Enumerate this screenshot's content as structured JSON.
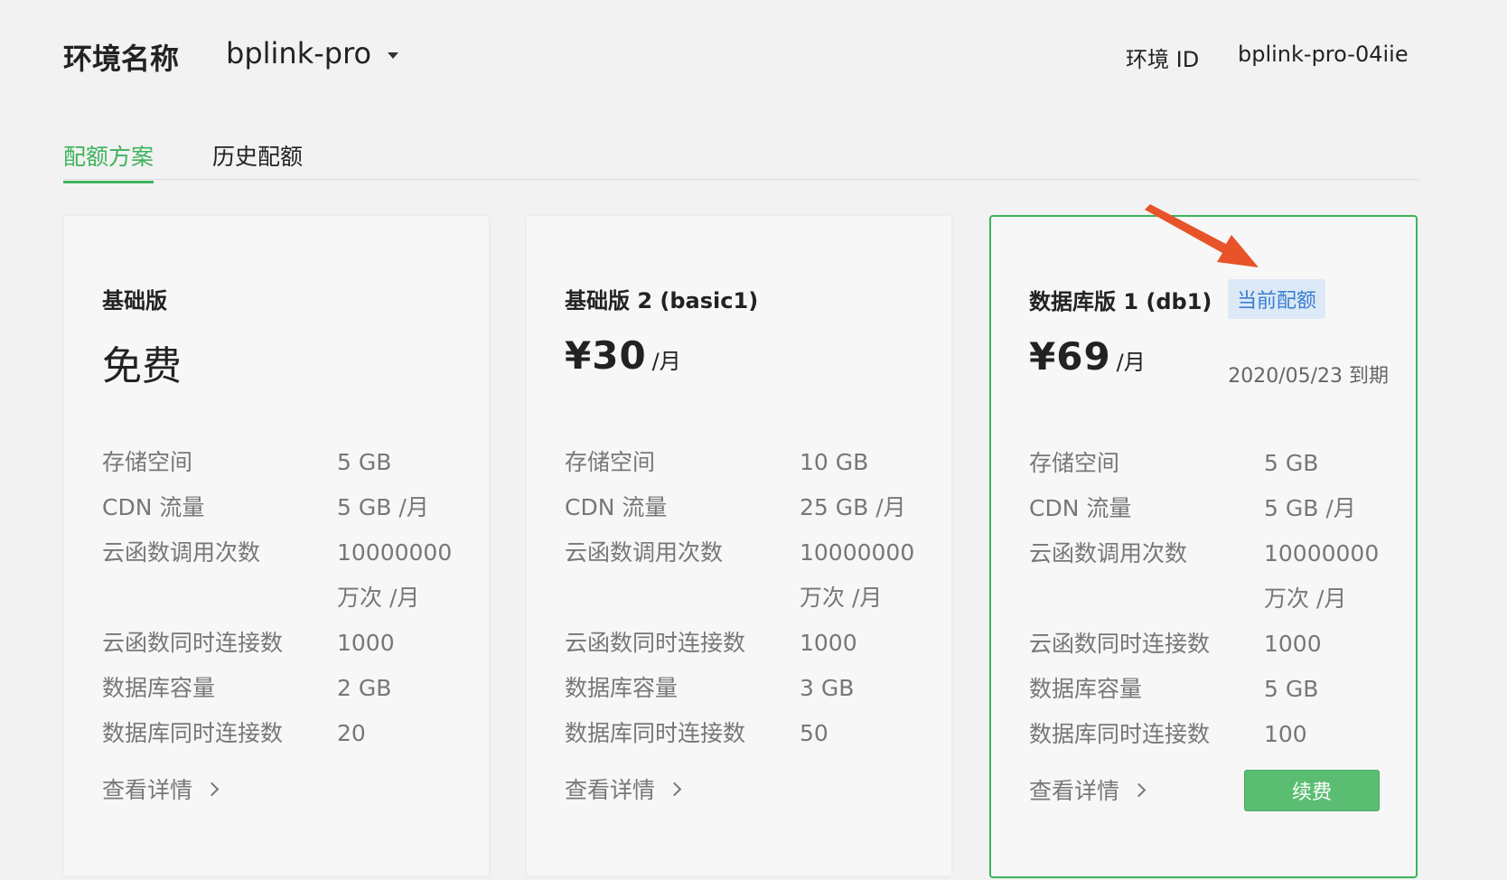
{
  "header": {
    "env_label": "环境名称",
    "env_value": "bplink-pro",
    "env_id_label": "环境 ID",
    "env_id_value": "bplink-pro-04iie"
  },
  "tabs": [
    {
      "label": "配额方案",
      "active": true
    },
    {
      "label": "历史配额",
      "active": false
    }
  ],
  "colors": {
    "accent": "#3fb35d",
    "badge_bg": "#dde9f6",
    "badge_text": "#3a7fd0",
    "arrow": "#e8532a"
  },
  "cards": [
    {
      "name": "基础版",
      "price": "免费",
      "specs": [
        {
          "label": "存储空间",
          "value": "5 GB"
        },
        {
          "label": "CDN 流量",
          "value": "5 GB /月"
        },
        {
          "label": "云函数调用次数",
          "value": "10000000",
          "value2": "万次 /月"
        },
        {
          "label": "云函数同时连接数",
          "value": "1000"
        },
        {
          "label": "数据库容量",
          "value": "2 GB"
        },
        {
          "label": "数据库同时连接数",
          "value": "20"
        }
      ],
      "details": "查看详情"
    },
    {
      "name": "基础版 2 (basic1)",
      "price": "¥30",
      "unit": "/月",
      "specs": [
        {
          "label": "存储空间",
          "value": "10 GB"
        },
        {
          "label": "CDN 流量",
          "value": "25 GB /月"
        },
        {
          "label": "云函数调用次数",
          "value": "10000000",
          "value2": "万次 /月"
        },
        {
          "label": "云函数同时连接数",
          "value": "1000"
        },
        {
          "label": "数据库容量",
          "value": "3 GB"
        },
        {
          "label": "数据库同时连接数",
          "value": "50"
        }
      ],
      "details": "查看详情"
    },
    {
      "name": "数据库版 1 (db1)",
      "badge": "当前配额",
      "price": "¥69",
      "unit": "/月",
      "expiry": "2020/05/23 到期",
      "specs": [
        {
          "label": "存储空间",
          "value": "5 GB"
        },
        {
          "label": "CDN 流量",
          "value": "5 GB /月"
        },
        {
          "label": "云函数调用次数",
          "value": "10000000",
          "value2": "万次 /月"
        },
        {
          "label": "云函数同时连接数",
          "value": "1000"
        },
        {
          "label": "数据库容量",
          "value": "5 GB"
        },
        {
          "label": "数据库同时连接数",
          "value": "100"
        }
      ],
      "details": "查看详情",
      "renew_label": "续费"
    }
  ]
}
